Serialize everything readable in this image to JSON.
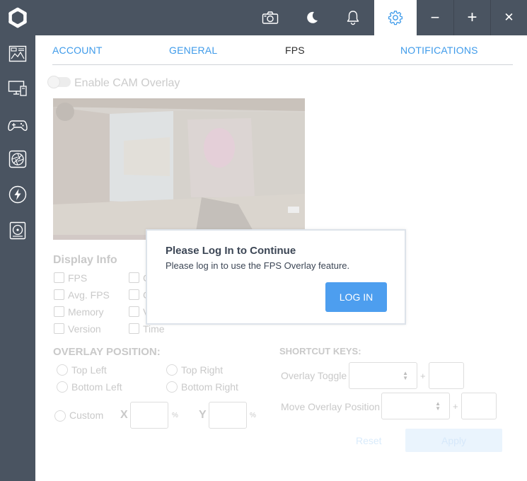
{
  "topbar": {
    "icons": [
      "camera-icon",
      "moon-icon",
      "bell-icon",
      "gear-icon",
      "minimize-icon",
      "maximize-icon",
      "close-icon"
    ],
    "minimize_glyph": "−",
    "maximize_glyph": "+",
    "close_glyph": "✕"
  },
  "sidebar": {
    "items": [
      "dashboard-icon",
      "monitor-icon",
      "gamepad-icon",
      "aperture-icon",
      "bolt-icon",
      "drive-icon"
    ]
  },
  "tabs": [
    {
      "label": "ACCOUNT"
    },
    {
      "label": "GENERAL"
    },
    {
      "label": "FPS"
    },
    {
      "label": "NOTIFICATIONS"
    }
  ],
  "overlay": {
    "toggle_label": "Enable CAM Overlay"
  },
  "display_info": {
    "title": "Display Info",
    "options": [
      "FPS",
      "Avg. FPS",
      "Memory",
      "Version"
    ],
    "options_col2_fragments": [
      "C",
      "C",
      "V",
      "Time"
    ]
  },
  "overlay_position": {
    "title": "OVERLAY POSITION:",
    "options": [
      "Top Left",
      "Top Right",
      "Bottom Left",
      "Bottom Right"
    ],
    "custom_label": "Custom",
    "x_label": "X",
    "y_label": "Y",
    "percent": "%"
  },
  "shortcut_keys": {
    "title": "SHORTCUT KEYS:",
    "overlay_toggle": "Overlay Toggle",
    "move_overlay": "Move Overlay Position",
    "plus": "+"
  },
  "actions": {
    "reset": "Reset",
    "apply": "Apply"
  },
  "modal": {
    "title": "Please Log In to Continue",
    "message": "Please log in to use the FPS Overlay feature.",
    "button": "LOG IN"
  },
  "colors": {
    "chrome": "#4a5461",
    "accent": "#3f9bea",
    "login_button": "#4d9eef"
  }
}
